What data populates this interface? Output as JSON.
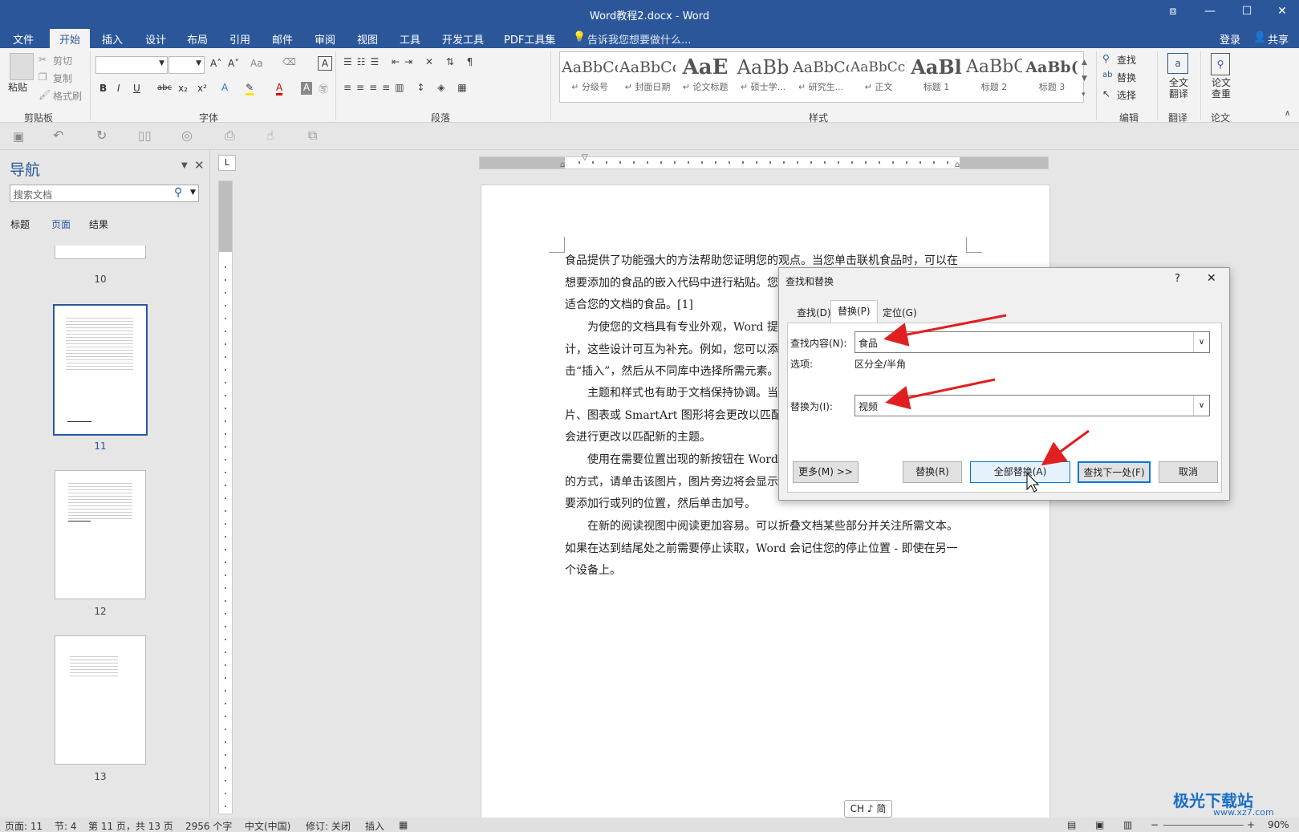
{
  "title": "Word教程2.docx - Word",
  "window_buttons": {
    "restore_ribbon": "⧈",
    "minimize": "—",
    "maximize": "☐",
    "close": "✕"
  },
  "menu": {
    "file": "文件",
    "tabs": [
      "开始",
      "插入",
      "设计",
      "布局",
      "引用",
      "邮件",
      "审阅",
      "视图",
      "工具",
      "开发工具",
      "PDF工具集"
    ],
    "tell": "告诉我您想要做什么...",
    "login": "登录",
    "share": "共享"
  },
  "ribbon": {
    "clipboard": {
      "paste": "粘贴",
      "cut": "剪切",
      "copy": "复制",
      "format": "格式刷",
      "label": "剪贴板"
    },
    "font": {
      "label": "字体",
      "grow": "A˄",
      "shrink": "A˅",
      "case": "Aa",
      "bold": "B",
      "italic": "I",
      "underline": "U",
      "strike": "abc",
      "sub": "x₂",
      "sup": "x²",
      "color": "A"
    },
    "paragraph": {
      "label": "段落"
    },
    "styles": {
      "label": "样式",
      "items": [
        {
          "preview": "AaBbCc",
          "name": "↵ 分级号"
        },
        {
          "preview": "AaBbCc",
          "name": "↵ 封面日期"
        },
        {
          "preview": "AaE",
          "name": "↵ 论文标题"
        },
        {
          "preview": "AaBb",
          "name": "↵ 硕士学..."
        },
        {
          "preview": "AaBbCc",
          "name": "↵ 研究生..."
        },
        {
          "preview": "AaBbCcI",
          "name": "↵ 正文"
        },
        {
          "preview": "AaBl",
          "name": "标题 1"
        },
        {
          "preview": "AaBbC",
          "name": "标题 2"
        },
        {
          "preview": "AaBb(",
          "name": "标题 3"
        }
      ]
    },
    "editing": {
      "find": "查找",
      "replace": "替换",
      "select": "选择",
      "label": "编辑"
    },
    "translate": {
      "full": "全文翻译",
      "label": "翻译"
    },
    "thesis": {
      "check": "论文查重",
      "label": "论文"
    }
  },
  "nav": {
    "title": "导航",
    "search_placeholder": "搜索文档",
    "tabs": [
      "标题",
      "页面",
      "结果"
    ],
    "pages": [
      "10",
      "11",
      "12",
      "13"
    ]
  },
  "ruler_tab": "L",
  "document": {
    "paragraphs": [
      "食品提供了功能强大的方法帮助您证明您的观点。当您单击联机食品时，可以在想要添加的食品的嵌入代码中进行粘贴。您也可以键入一个关键字以联机搜索最适合您的文档的食品。[1]",
      "为使您的文档具有专业外观，Word 提供了页眉、页脚、封面和文本框设计，这些设计可互为补充。例如，您可以添加匹配的封面、页眉和提要栏。单击“插入”，然后从不同库中选择所需元素。",
      "主题和样式也有助于文档保持协调。当您单击设计并选择新的主题时，图片、图表或 SmartArt 图形将会更改以匹配新的主题。当应用样式时，您的标题会进行更改以匹配新的主题。",
      "使用在需要位置出现的新按钮在 Word 中保存时间。若要更改图片适应文档的方式，请单击该图片，图片旁边将会显示布局选项按钮。当处理表格时，单击要添加行或列的位置，然后单击加号。",
      "在新的阅读视图中阅读更加容易。可以折叠文档某些部分并关注所需文本。如果在达到结尾处之前需要停止读取，Word 会记住您的停止位置 - 即使在另一个设备上。"
    ]
  },
  "dialog": {
    "title": "查找和替换",
    "help": "?",
    "close": "✕",
    "tabs": [
      "查找(D)",
      "替换(P)",
      "定位(G)"
    ],
    "find_label": "查找内容(N):",
    "find_value": "食品",
    "options_label": "选项:",
    "options_value": "区分全/半角",
    "replace_label": "替换为(I):",
    "replace_value": "视频",
    "buttons": {
      "more": "更多(M) >>",
      "replace": "替换(R)",
      "replace_all": "全部替换(A)",
      "find_next": "查找下一处(F)",
      "cancel": "取消"
    }
  },
  "ime": "CH ♪ 简",
  "status": {
    "page": "页面: 11",
    "section": "节: 4",
    "page_of": "第 11 页，共 13 页",
    "words": "2956 个字",
    "lang": "中文(中国)",
    "track": "修订: 关闭",
    "insert": "插入",
    "zoom": "90%"
  },
  "watermark": {
    "brand": "极光下载站",
    "url": "www.xz7.com"
  },
  "colors": {
    "accent": "#2b579a",
    "arrow": "#e02020"
  }
}
